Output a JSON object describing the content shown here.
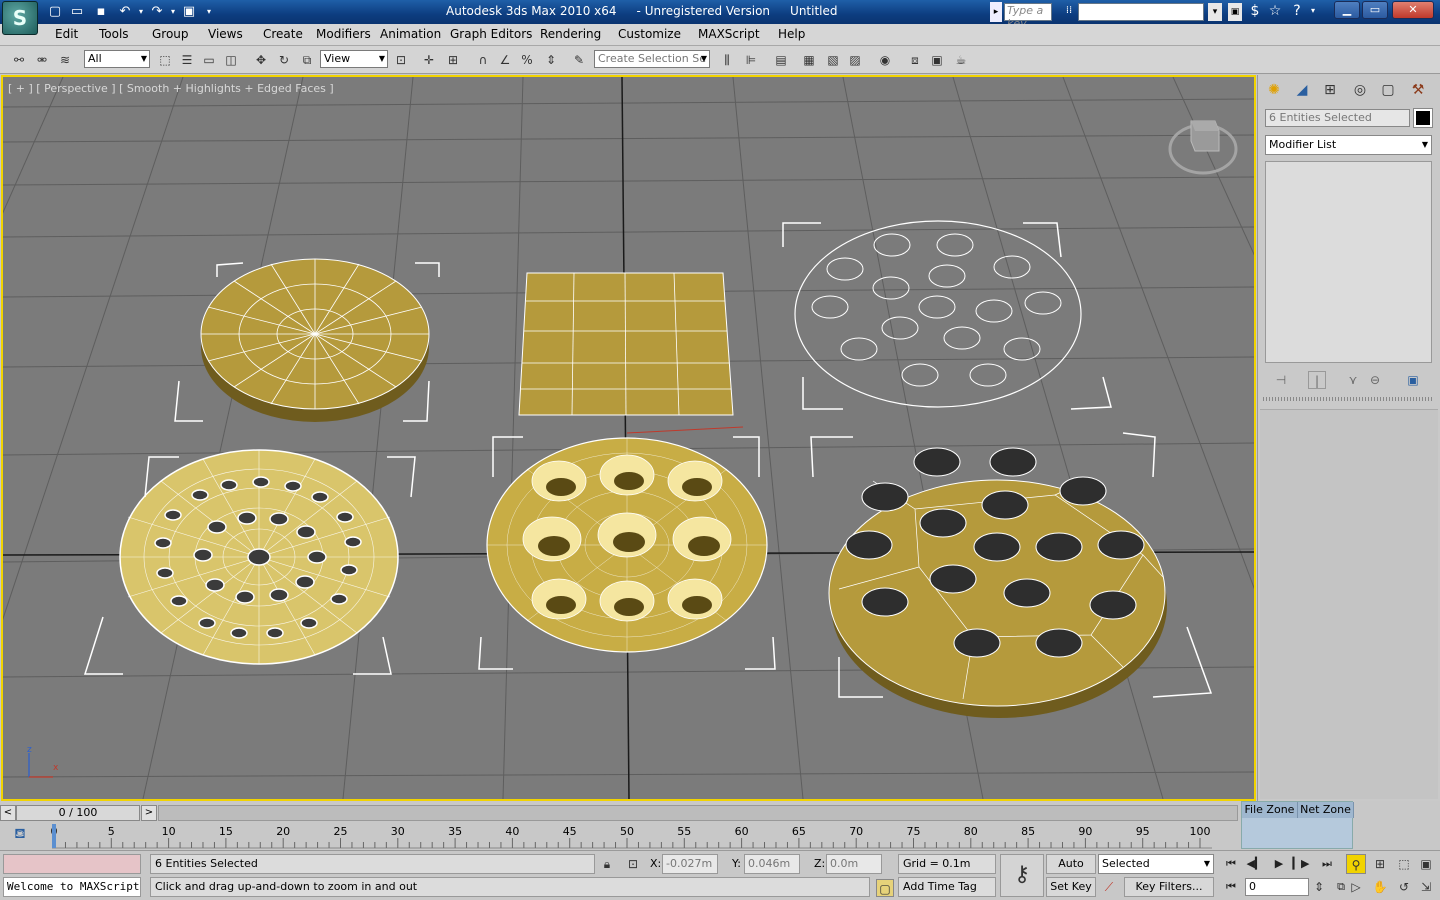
{
  "titlebar": {
    "app_name": "Autodesk 3ds Max  2010 x64",
    "version_note": "- Unregistered Version",
    "doc_name": "Untitled",
    "search_placeholder": "Type a key"
  },
  "menu": [
    "Edit",
    "Tools",
    "Group",
    "Views",
    "Create",
    "Modifiers",
    "Animation",
    "Graph Editors",
    "Rendering",
    "Customize",
    "MAXScript",
    "Help"
  ],
  "toolbar": {
    "filter_value": "All",
    "refcoord_value": "View",
    "selection_set_placeholder": "Create Selection Se"
  },
  "viewport": {
    "label": "[ + ] [ Perspective ] [ Smooth + Highlights + Edged Faces ]",
    "axis_z": "z",
    "axis_x": "x",
    "colors": {
      "background": "#7b7b7b",
      "active_border": "#f1d300",
      "object": "#b59a3c"
    }
  },
  "command_panel": {
    "name_field": "6 Entities Selected",
    "modifier_list": "Modifier List"
  },
  "time": {
    "slider_label": "0 / 100",
    "ticks": [
      "0",
      "5",
      "10",
      "15",
      "20",
      "25",
      "30",
      "35",
      "40",
      "45",
      "50",
      "55",
      "60",
      "65",
      "70",
      "75",
      "80",
      "85",
      "90",
      "95",
      "100"
    ]
  },
  "zones": {
    "file": "File Zone",
    "net": "Net Zone"
  },
  "status": {
    "maxscript": "Welcome to MAXScript.",
    "selection": "6 Entities Selected",
    "prompt": "Click and drag up-and-down to zoom in and out",
    "x_label": "X:",
    "x_value": "-0.027m",
    "y_label": "Y:",
    "y_value": "0.046m",
    "z_label": "Z:",
    "z_value": "0.0m",
    "grid": "Grid = 0.1m",
    "add_time_tag": "Add Time Tag",
    "auto_key": "Auto Key",
    "set_key": "Set Key",
    "selected": "Selected",
    "key_filters": "Key Filters...",
    "frame": "0"
  }
}
